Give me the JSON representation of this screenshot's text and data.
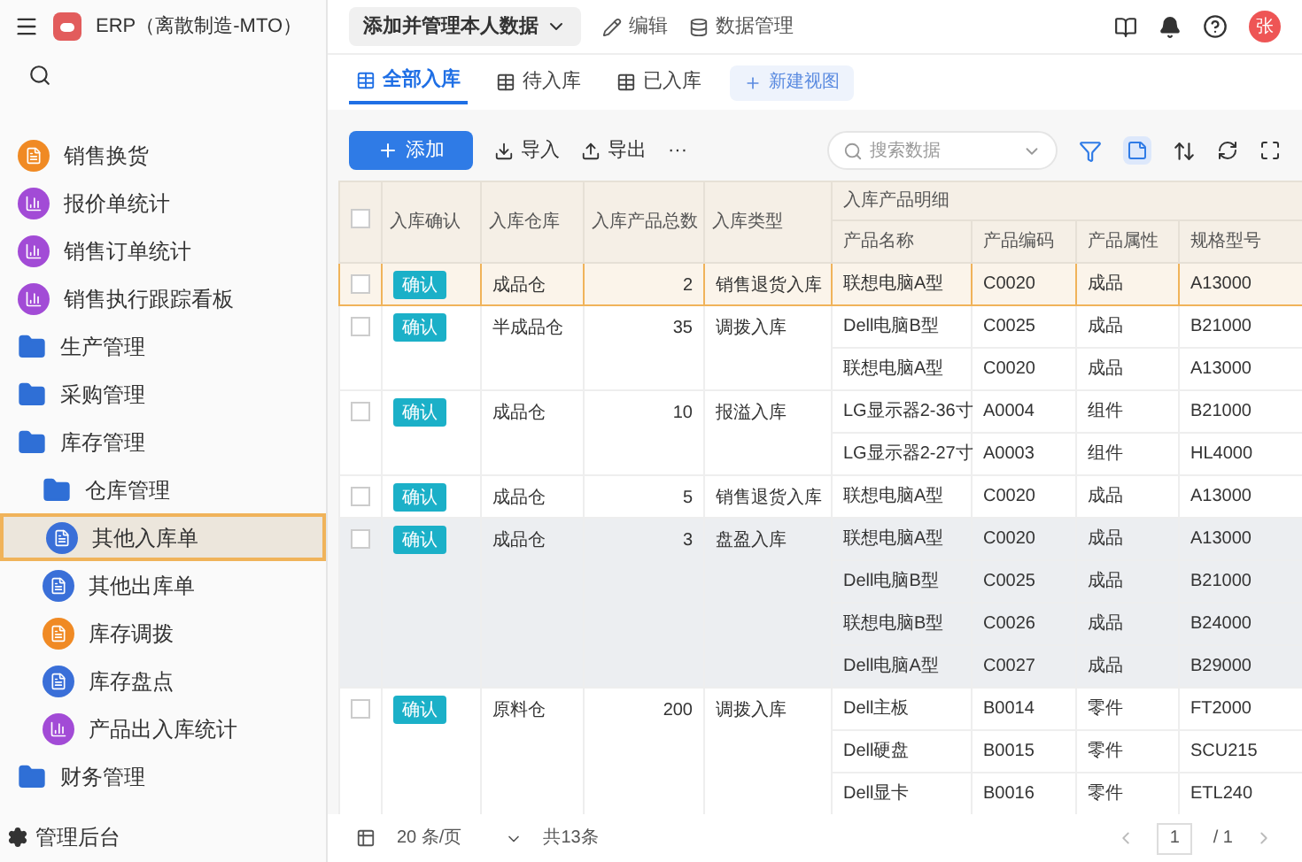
{
  "app": {
    "title": "ERP（离散制造-MTO）",
    "view_menu": "添加并管理本人数据",
    "edit": "编辑",
    "data_manage": "数据管理",
    "avatar": "张"
  },
  "sidebar": {
    "items": [
      {
        "label": "销售换货",
        "kind": "form",
        "color": "#f08a24",
        "selected": false
      },
      {
        "label": "报价单统计",
        "kind": "chart",
        "color": "#a24bd6",
        "selected": false
      },
      {
        "label": "销售订单统计",
        "kind": "chart",
        "color": "#a24bd6",
        "selected": false
      },
      {
        "label": "销售执行跟踪看板",
        "kind": "chart",
        "color": "#a24bd6",
        "selected": false
      },
      {
        "label": "生产管理",
        "kind": "folder",
        "color": "#2f6fd6",
        "selected": false
      },
      {
        "label": "采购管理",
        "kind": "folder",
        "color": "#2f6fd6",
        "selected": false
      },
      {
        "label": "库存管理",
        "kind": "folder",
        "color": "#2f6fd6",
        "selected": false,
        "children": [
          {
            "label": "仓库管理",
            "kind": "folder",
            "color": "#2f6fd6",
            "selected": false
          },
          {
            "label": "其他入库单",
            "kind": "form",
            "color": "#3a6fd8",
            "selected": true
          },
          {
            "label": "其他出库单",
            "kind": "form",
            "color": "#3a6fd8",
            "selected": false
          },
          {
            "label": "库存调拨",
            "kind": "form",
            "color": "#f08a24",
            "selected": false
          },
          {
            "label": "库存盘点",
            "kind": "form",
            "color": "#3a6fd8",
            "selected": false
          },
          {
            "label": "产品出入库统计",
            "kind": "chart",
            "color": "#a24bd6",
            "selected": false
          }
        ]
      },
      {
        "label": "财务管理",
        "kind": "folder",
        "color": "#2f6fd6",
        "selected": false
      }
    ],
    "footer": "管理后台"
  },
  "tabs": [
    {
      "label": "全部入库",
      "selected": true
    },
    {
      "label": "待入库",
      "selected": false
    },
    {
      "label": "已入库",
      "selected": false
    }
  ],
  "new_view": "新建视图",
  "toolbar": {
    "add": "添加",
    "import": "导入",
    "export": "导出",
    "more": "···",
    "search_placeholder": "搜索数据"
  },
  "table": {
    "all_checked": false,
    "columns": [
      "入库确认",
      "入库仓库",
      "入库产品总数",
      "入库类型"
    ],
    "group": "入库产品明细",
    "sub_columns": [
      "产品名称",
      "产品编码",
      "产品属性",
      "规格型号"
    ],
    "rows": [
      {
        "checked": false,
        "selected": true,
        "highlighted": false,
        "confirm": "确认",
        "warehouse": "成品仓",
        "total": "2",
        "type": "销售退货入库",
        "products": [
          [
            "联想电脑A型",
            "C0020",
            "成品",
            "A13000"
          ]
        ]
      },
      {
        "checked": false,
        "selected": false,
        "highlighted": false,
        "confirm": "确认",
        "warehouse": "半成品仓",
        "total": "35",
        "type": "调拨入库",
        "products": [
          [
            "Dell电脑B型",
            "C0025",
            "成品",
            "B21000"
          ],
          [
            "联想电脑A型",
            "C0020",
            "成品",
            "A13000"
          ]
        ]
      },
      {
        "checked": false,
        "selected": false,
        "highlighted": false,
        "confirm": "确认",
        "warehouse": "成品仓",
        "total": "10",
        "type": "报溢入库",
        "products": [
          [
            "LG显示器2-36寸",
            "A0004",
            "组件",
            "B21000"
          ],
          [
            "LG显示器2-27寸",
            "A0003",
            "组件",
            "HL4000"
          ]
        ]
      },
      {
        "checked": false,
        "selected": false,
        "highlighted": false,
        "confirm": "确认",
        "warehouse": "成品仓",
        "total": "5",
        "type": "销售退货入库",
        "products": [
          [
            "联想电脑A型",
            "C0020",
            "成品",
            "A13000"
          ]
        ]
      },
      {
        "checked": false,
        "selected": false,
        "highlighted": true,
        "confirm": "确认",
        "warehouse": "成品仓",
        "total": "3",
        "type": "盘盈入库",
        "products": [
          [
            "联想电脑A型",
            "C0020",
            "成品",
            "A13000"
          ],
          [
            "Dell电脑B型",
            "C0025",
            "成品",
            "B21000"
          ],
          [
            "联想电脑B型",
            "C0026",
            "成品",
            "B24000"
          ],
          [
            "Dell电脑A型",
            "C0027",
            "成品",
            "B29000"
          ]
        ]
      },
      {
        "checked": false,
        "selected": false,
        "highlighted": false,
        "confirm": "确认",
        "warehouse": "原料仓",
        "total": "200",
        "type": "调拨入库",
        "products": [
          [
            "Dell主板",
            "B0014",
            "零件",
            "FT2000"
          ],
          [
            "Dell硬盘",
            "B0015",
            "零件",
            "SCU215"
          ],
          [
            "Dell显卡",
            "B0016",
            "零件",
            "ETL240"
          ]
        ]
      }
    ]
  },
  "pagination": {
    "page_size": "20 条/页",
    "total": "共13条",
    "page": "1",
    "pages": "/ 1"
  }
}
